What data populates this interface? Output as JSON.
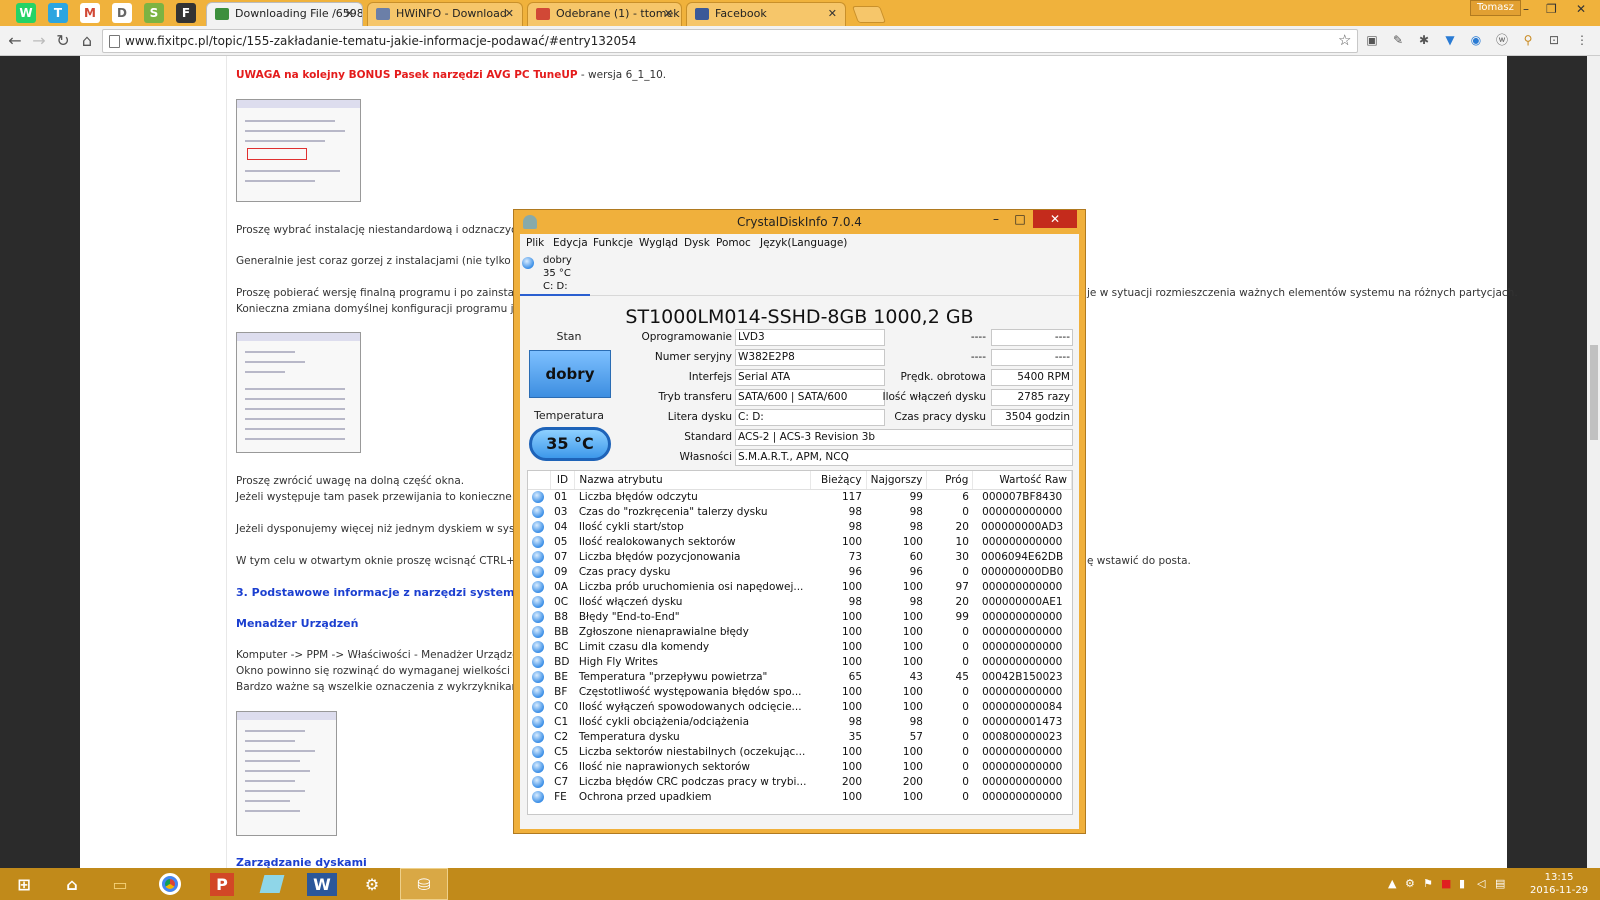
{
  "browser": {
    "tabs": [
      {
        "label": "Downloading File /6598",
        "color": "#3c8f3c"
      },
      {
        "label": "HWiNFO - Download",
        "color": "#6b7fa8"
      },
      {
        "label": "Odebrane (1) - ttomek",
        "color": "#d14836"
      },
      {
        "label": "Facebook",
        "color": "#3b5998"
      }
    ],
    "pinned": [
      "W",
      "T",
      "M",
      "D",
      "S",
      "F"
    ],
    "user": "Tomasz",
    "url": "www.fixitpc.pl/topic/155-zakładanie-tematu-jakie-informacje-podawać/#entry132054"
  },
  "page": {
    "bonus_text": "UWAGA na kolejny BONUS Pasek narzędzi AVG PC TuneUP",
    "version_text": " - wersja 6_1_10.",
    "p1": "Proszę wybrać instalację niestandardową i odznaczyć ptaszka.",
    "p2": "Generalnie jest coraz gorzej z instalacjami (nie tylko tego softu",
    "p3a": "Proszę pobierać wersję finalną programu i po zainstalowaniu o",
    "p3b": "Konieczna zmiana domyślnej konfiguracji programu jak na obr",
    "p3c": "je w sytuacji rozmieszczenia ważnych elementów systemu na różnych partycjach.",
    "p4a": "Proszę zwrócić uwagę na dolną część okna.",
    "p4b": "Jeżeli występuje tam pasek przewijania to konieczne jest stoso",
    "p5": "Jeżeli dysponujemy więcej niż jednym dyskiem w systemie mo",
    "p6a": "W tym celu w otwartym oknie proszę wcisnąć CTRL+C -> uru",
    "p6b": "ę wstawić do posta.",
    "h3": "3. Podstawowe informacje z narzędzi systemowych:",
    "h_mgr": "Menadżer Urządzeń",
    "p7a": "Komputer -> PPM -> Właściwości - Menadżer Urządzeń lub St",
    "p7b": "Okno powinno się rozwinąć do wymaganej wielkości tak aby b",
    "p7c": "Bardzo ważne są wszelkie oznaczenia z wykrzyknikami.",
    "h_disks": "Zarządzanie dyskami"
  },
  "cdi": {
    "title": "CrystalDiskInfo 7.0.4",
    "menu": [
      "Plik",
      "Edycja",
      "Funkcje",
      "Wygląd",
      "Dysk",
      "Pomoc",
      "Język(Language)"
    ],
    "disk_tab": {
      "status": "dobry",
      "temp": "35 °C",
      "letters": "C: D:"
    },
    "disk_heading": "ST1000LM014-SSHD-8GB 1000,2 GB",
    "stan_label": "Stan",
    "health": "dobry",
    "temp_label": "Temperatura",
    "temp": "35 °C",
    "fields": {
      "firmware_label": "Oprogramowanie",
      "firmware": "LVD3",
      "serial_label": "Numer seryjny",
      "serial": "W382E2P8",
      "interface_label": "Interfejs",
      "interface": "Serial ATA",
      "transfer_label": "Tryb transferu",
      "transfer": "SATA/600 | SATA/600",
      "letter_label": "Litera dysku",
      "letter": "C: D:",
      "standard_label": "Standard",
      "standard": "ACS-2 | ACS-3 Revision 3b",
      "features_label": "Własności",
      "features": "S.M.A.R.T., APM, NCQ",
      "blank_label": "----",
      "blank_value": "----",
      "rpm_label": "Prędk. obrotowa",
      "rpm": "5400 RPM",
      "power_count_label": "Ilość włączeń dysku",
      "power_count": "2785 razy",
      "hours_label": "Czas pracy dysku",
      "hours": "3504 godzin"
    },
    "columns": [
      "ID",
      "Nazwa atrybutu",
      "Bieżący",
      "Najgorszy",
      "Próg",
      "Wartość Raw"
    ],
    "rows": [
      [
        "01",
        "Liczba błędów odczytu",
        "117",
        "99",
        "6",
        "000007BF8430"
      ],
      [
        "03",
        "Czas do \"rozkręcenia\" talerzy dysku",
        "98",
        "98",
        "0",
        "000000000000"
      ],
      [
        "04",
        "Ilość cykli start/stop",
        "98",
        "98",
        "20",
        "000000000AD3"
      ],
      [
        "05",
        "Ilość realokowanych sektorów",
        "100",
        "100",
        "10",
        "000000000000"
      ],
      [
        "07",
        "Liczba błędów pozycjonowania",
        "73",
        "60",
        "30",
        "0006094E62DB"
      ],
      [
        "09",
        "Czas pracy dysku",
        "96",
        "96",
        "0",
        "000000000DB0"
      ],
      [
        "0A",
        "Liczba prób uruchomienia osi napędowej...",
        "100",
        "100",
        "97",
        "000000000000"
      ],
      [
        "0C",
        "Ilość włączeń dysku",
        "98",
        "98",
        "20",
        "000000000AE1"
      ],
      [
        "B8",
        "Błędy \"End-to-End\"",
        "100",
        "100",
        "99",
        "000000000000"
      ],
      [
        "BB",
        "Zgłoszone nienaprawialne błędy",
        "100",
        "100",
        "0",
        "000000000000"
      ],
      [
        "BC",
        "Limit czasu dla komendy",
        "100",
        "100",
        "0",
        "000000000000"
      ],
      [
        "BD",
        "High Fly Writes",
        "100",
        "100",
        "0",
        "000000000000"
      ],
      [
        "BE",
        "Temperatura \"przepływu powietrza\"",
        "65",
        "43",
        "45",
        "00042B150023"
      ],
      [
        "BF",
        "Częstotliwość występowania błędów spo...",
        "100",
        "100",
        "0",
        "000000000000"
      ],
      [
        "C0",
        "Ilość wyłączeń spowodowanych odcięcie...",
        "100",
        "100",
        "0",
        "000000000084"
      ],
      [
        "C1",
        "Ilość cykli obciążenia/odciążenia",
        "98",
        "98",
        "0",
        "000000001473"
      ],
      [
        "C2",
        "Temperatura dysku",
        "35",
        "57",
        "0",
        "000800000023"
      ],
      [
        "C5",
        "Liczba sektorów niestabilnych (oczekując...",
        "100",
        "100",
        "0",
        "000000000000"
      ],
      [
        "C6",
        "Ilość nie naprawionych sektorów",
        "100",
        "100",
        "0",
        "000000000000"
      ],
      [
        "C7",
        "Liczba błędów CRC podczas pracy w trybi...",
        "200",
        "200",
        "0",
        "000000000000"
      ],
      [
        "FE",
        "Ochrona przed upadkiem",
        "100",
        "100",
        "0",
        "000000000000"
      ]
    ]
  },
  "taskbar": {
    "apps": [
      "start-icon",
      "home-icon",
      "explorer-icon",
      "chrome-icon",
      "powerpoint-icon",
      "notepad-icon",
      "word-icon",
      "tool-icon",
      "crystaldiskinfo-icon"
    ],
    "time": "13:15",
    "date": "2016-11-29"
  }
}
